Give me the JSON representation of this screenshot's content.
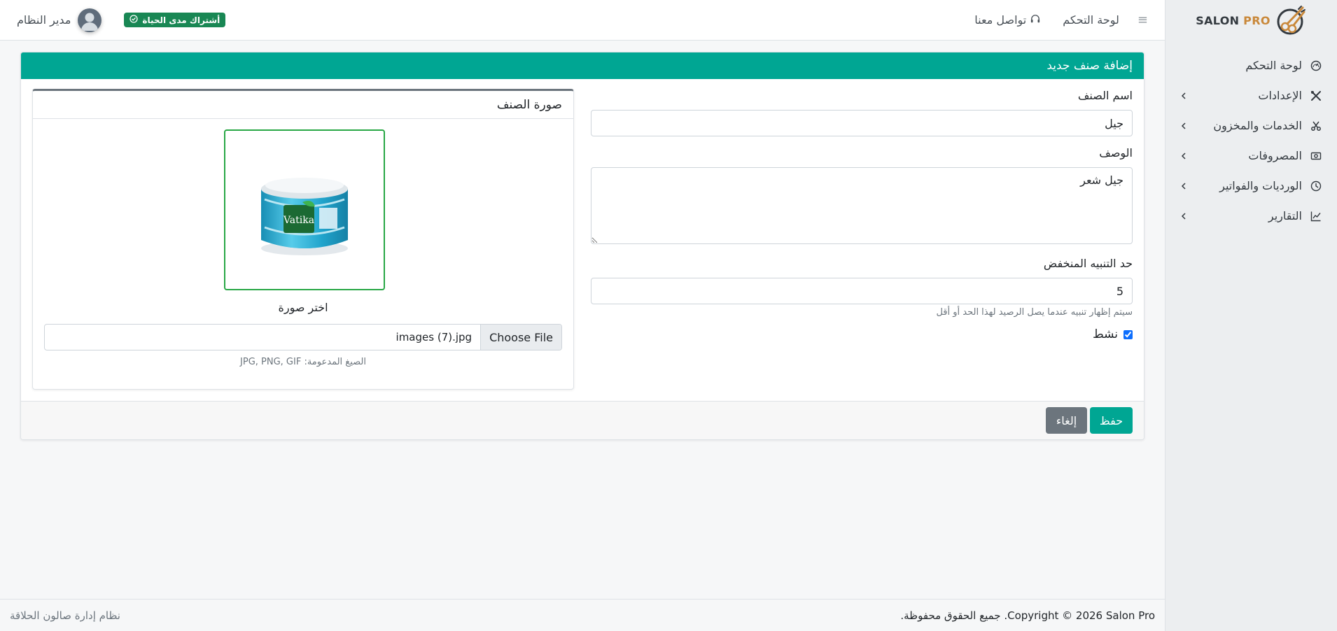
{
  "sidebar": {
    "brand_salon": "SALON ",
    "brand_pro": "PRO",
    "items": [
      {
        "label": "لوحة التحكم",
        "icon": "dashboard-icon",
        "has_children": false
      },
      {
        "label": "الإعدادات",
        "icon": "tools-icon",
        "has_children": true
      },
      {
        "label": "الخدمات والمخزون",
        "icon": "scissors-icon",
        "has_children": true
      },
      {
        "label": "المصروفات",
        "icon": "cash-icon",
        "has_children": true
      },
      {
        "label": "الورديات والفواتير",
        "icon": "clock-icon",
        "has_children": true
      },
      {
        "label": "التقارير",
        "icon": "chart-icon",
        "has_children": true
      }
    ]
  },
  "topbar": {
    "menu_toggle": "≡",
    "dashboard_link": "لوحة التحكم",
    "contact_link": "تواصل معنا",
    "subscription_badge": "أشتراك مدى الحياة",
    "user_name": "مدير النظام"
  },
  "card": {
    "title": "إضافة صنف جديد",
    "form": {
      "name_label": "اسم الصنف",
      "name_value": "جيل",
      "description_label": "الوصف",
      "description_value": "جيل شعر",
      "threshold_label": "حد التنبيه المنخفض",
      "threshold_value": "5",
      "threshold_hint": "سيتم إظهار تنبيه عندما يصل الرصيد لهذا الحد أو أقل",
      "active_label": "نشط",
      "active_checked": true
    },
    "image_panel": {
      "title": "صورة الصنف",
      "choose_label": "اختر صورة",
      "file_button": "Choose File",
      "file_name": "images (7).jpg",
      "formats": "الصيغ المدعومة: JPG, PNG, GIF",
      "product_brand": "Vatika"
    },
    "buttons": {
      "save": "حفظ",
      "cancel": "إلغاء"
    }
  },
  "footer": {
    "copyright": "Copyright © 2026 Salon Pro. جميع الحقوق محفوظة.",
    "system_name": "نظام إدارة صالون الحلاقة"
  },
  "colors": {
    "primary": "#00a693",
    "success": "#198754",
    "secondary": "#6c757d",
    "brand_gold": "#c9883a"
  }
}
